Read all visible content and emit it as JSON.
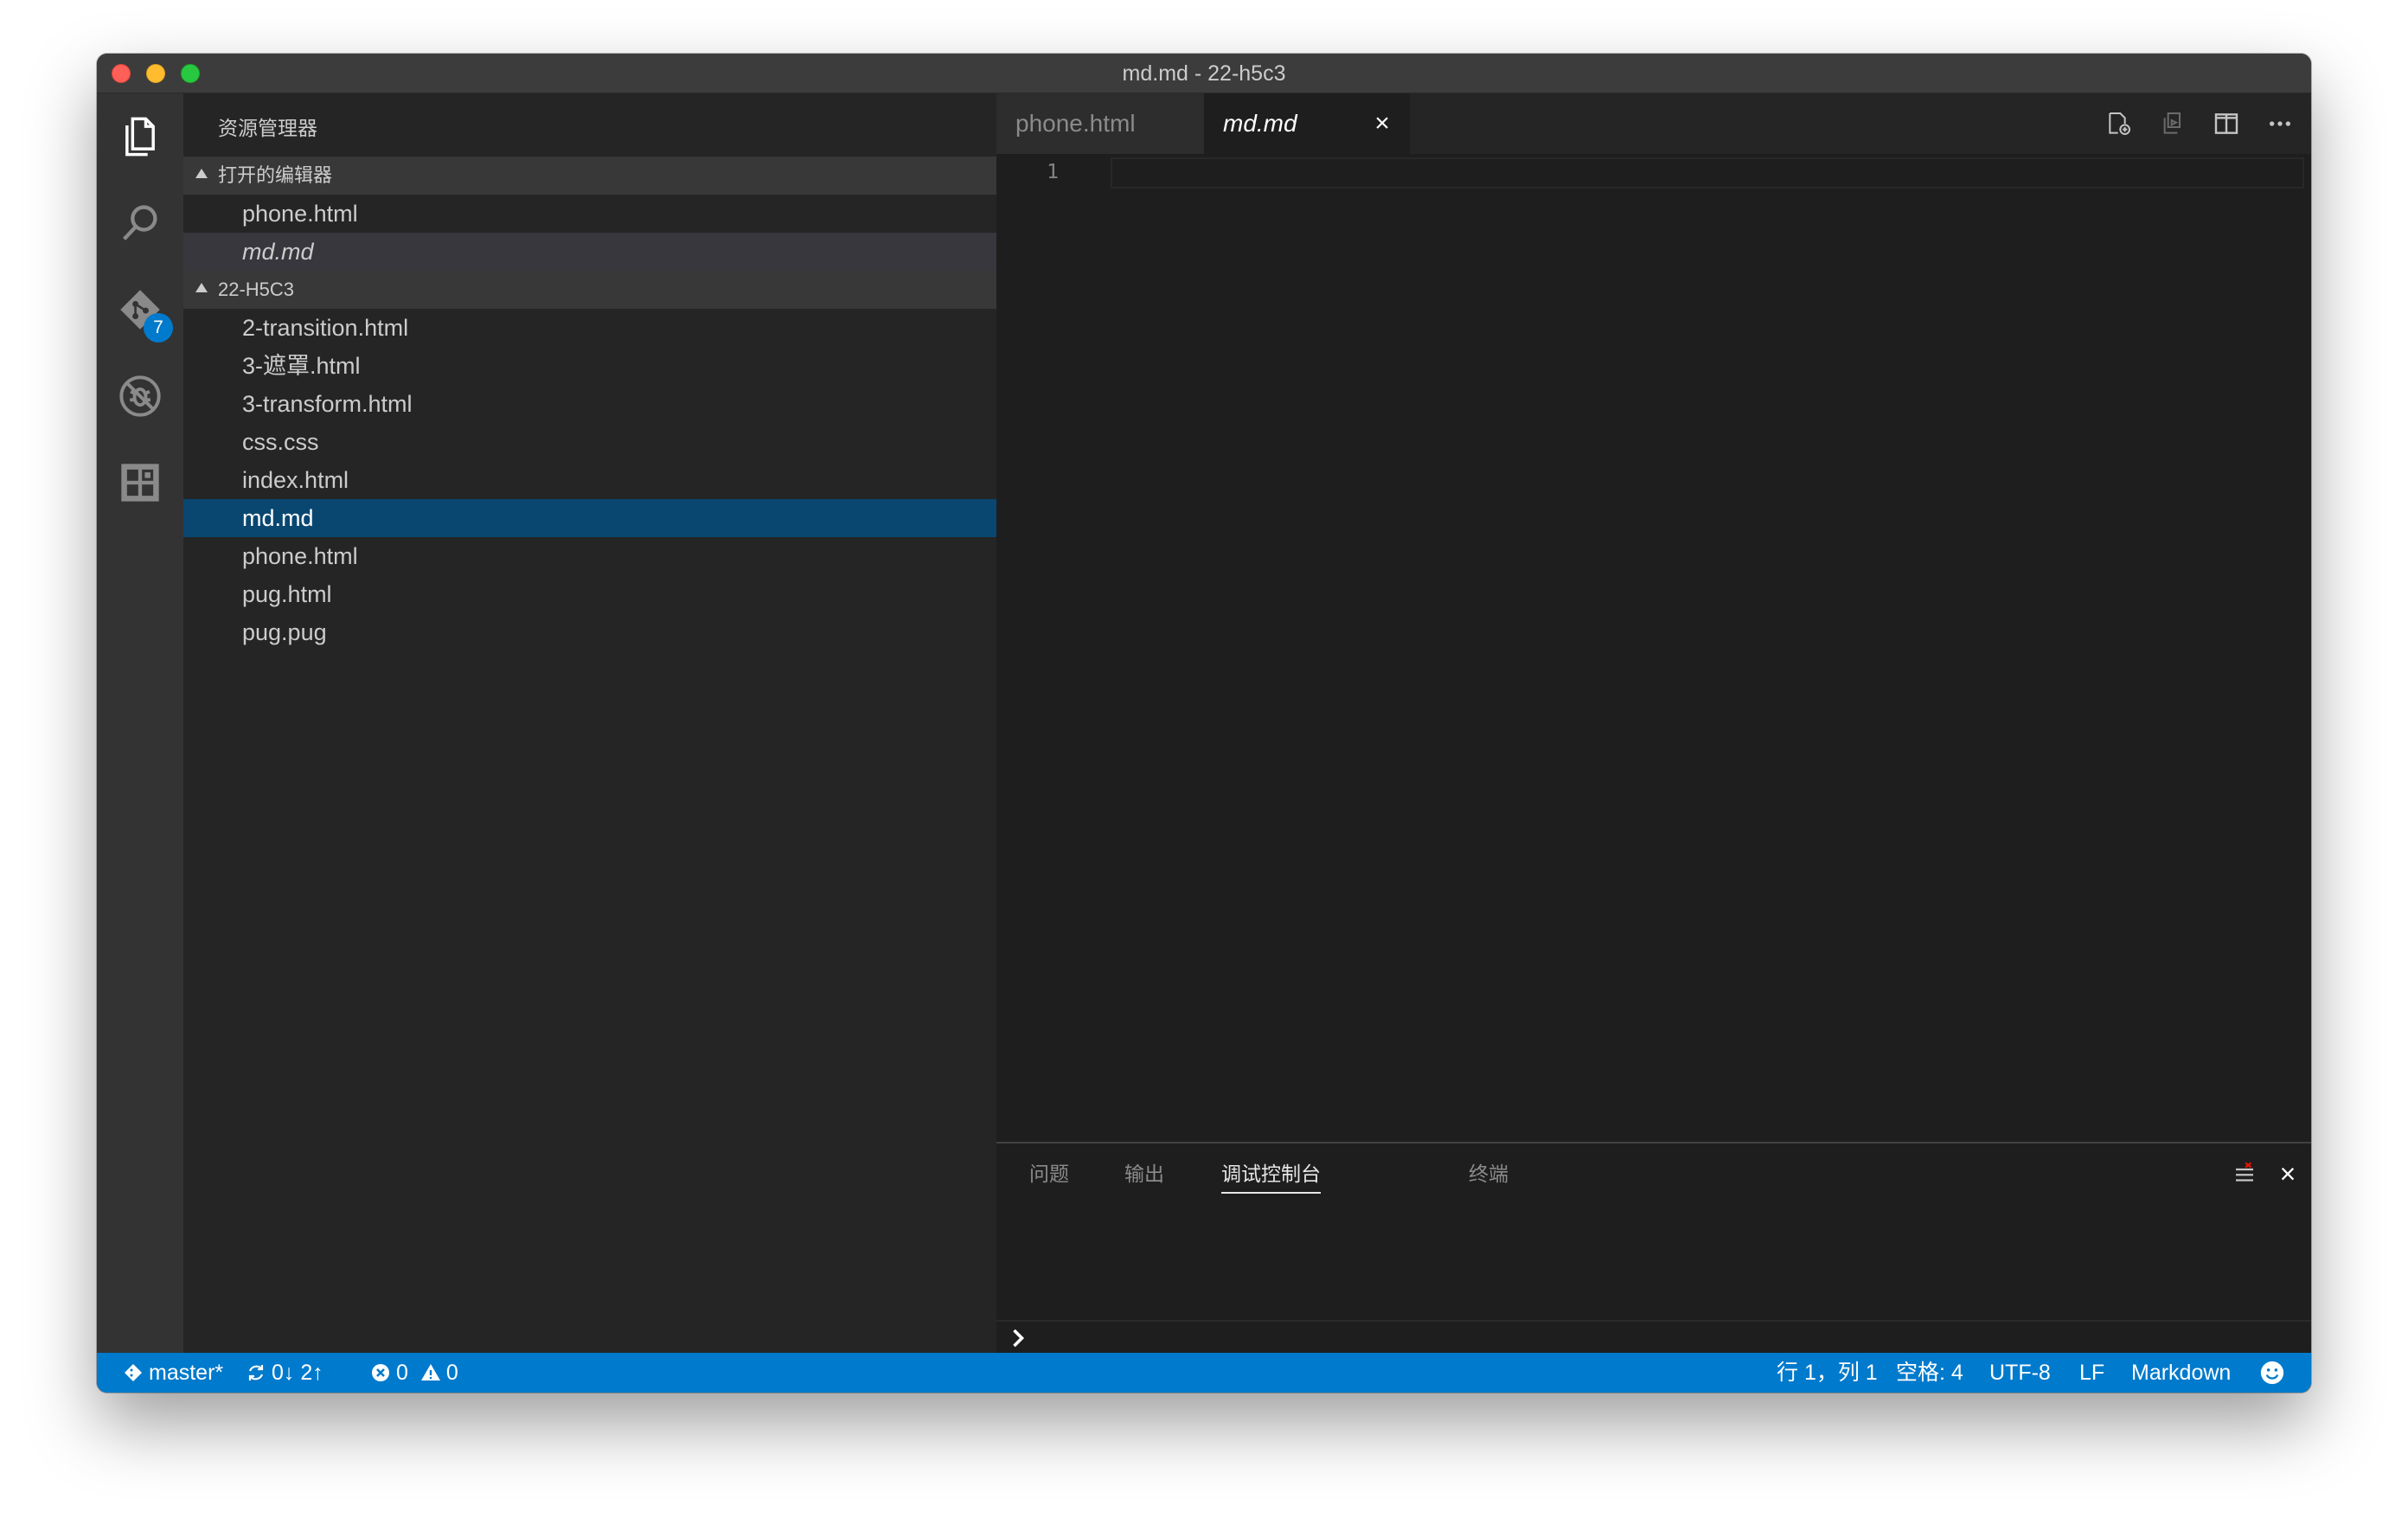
{
  "window": {
    "title": "md.md - 22-h5c3"
  },
  "activity_bar": {
    "items": [
      {
        "name": "explorer",
        "icon": "files-icon"
      },
      {
        "name": "search",
        "icon": "search-icon"
      },
      {
        "name": "source-control",
        "icon": "git-icon",
        "badge": "7"
      },
      {
        "name": "debug",
        "icon": "debug-icon"
      },
      {
        "name": "extensions",
        "icon": "extensions-icon"
      }
    ]
  },
  "sidebar": {
    "title": "资源管理器",
    "open_editors": {
      "header": "打开的编辑器",
      "items": [
        {
          "label": "phone.html"
        },
        {
          "label": "md.md"
        }
      ]
    },
    "folder": {
      "header": "22-H5C3",
      "items": [
        {
          "label": "2-transition.html"
        },
        {
          "label": "3-遮罩.html"
        },
        {
          "label": "3-transform.html"
        },
        {
          "label": "css.css"
        },
        {
          "label": "index.html"
        },
        {
          "label": "md.md"
        },
        {
          "label": "phone.html"
        },
        {
          "label": "pug.html"
        },
        {
          "label": "pug.pug"
        }
      ]
    }
  },
  "editor": {
    "tabs": [
      {
        "label": "phone.html"
      },
      {
        "label": "md.md",
        "close": "×"
      }
    ],
    "actions": [
      "open-changes-icon",
      "preview-icon",
      "split-editor-icon",
      "more-icon"
    ],
    "line_number": "1"
  },
  "panel": {
    "tabs": [
      {
        "label": "问题"
      },
      {
        "label": "输出"
      },
      {
        "label": "调试控制台"
      },
      {
        "label": "终端"
      }
    ],
    "close": "×"
  },
  "statusbar": {
    "branch": "master*",
    "sync": "0↓ 2↑",
    "errors": "0",
    "warnings": "0",
    "position": "行 1，列 1",
    "indent": "空格: 4",
    "encoding": "UTF-8",
    "eol": "LF",
    "language": "Markdown"
  },
  "colors": {
    "accent": "#007acc",
    "selection": "#094771"
  }
}
